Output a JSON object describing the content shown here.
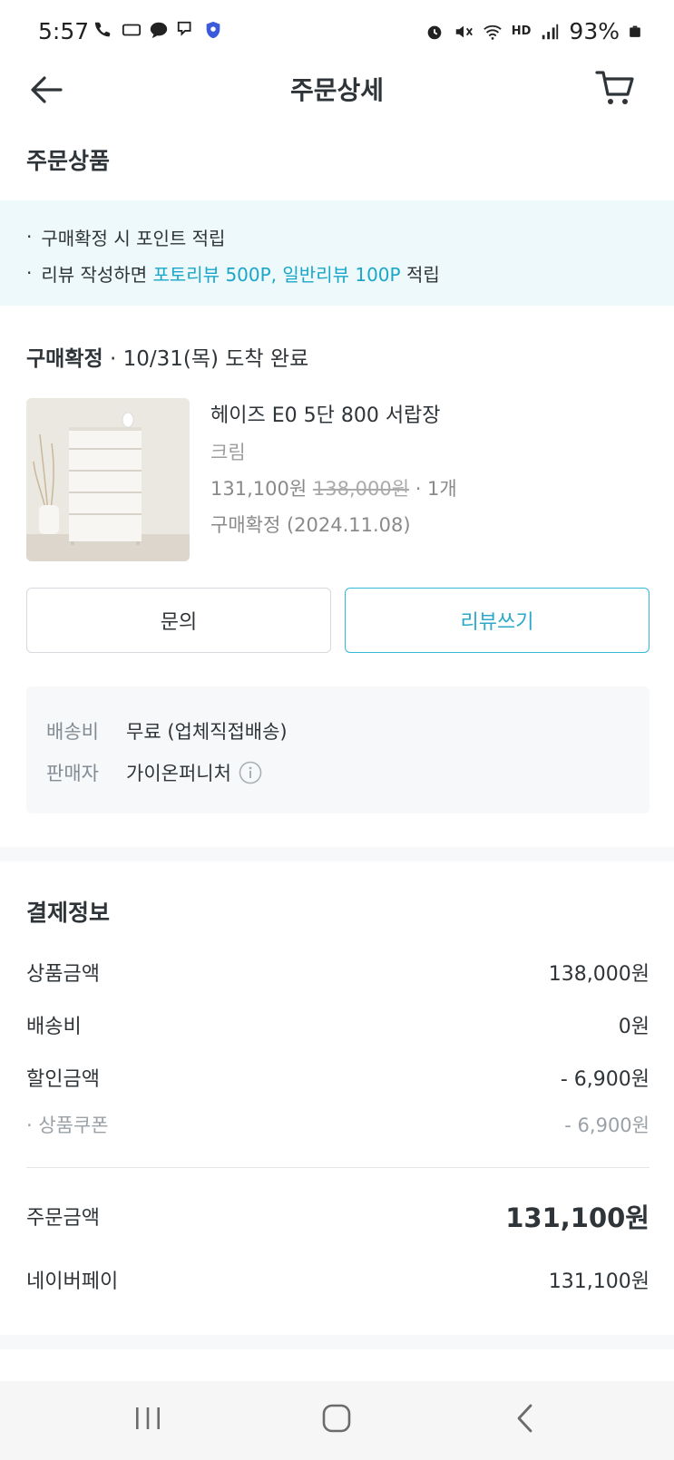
{
  "status_bar": {
    "time": "5:57",
    "battery": "93%",
    "hd_label": "HD"
  },
  "header": {
    "title": "주문상세"
  },
  "order_products_title": "주문상품",
  "notice": {
    "line1": "구매확정 시 포인트 적립",
    "line2_prefix": "리뷰 작성하면 ",
    "line2_highlight": "포토리뷰 500P, 일반리뷰 100P",
    "line2_suffix": " 적립"
  },
  "order_status": {
    "label": "구매확정",
    "detail": " · 10/31(목) 도착 완료"
  },
  "product": {
    "name": "헤이즈 E0 5단 800 서랍장",
    "option": "크림",
    "price": "131,100원",
    "original_price": "138,000원",
    "quantity": " · 1개",
    "confirm_date": "구매확정 (2024.11.08)"
  },
  "buttons": {
    "inquiry": "문의",
    "review": "리뷰쓰기"
  },
  "delivery": {
    "fee_label": "배송비",
    "fee_value": "무료 (업체직접배송)",
    "seller_label": "판매자",
    "seller_value": "가이온퍼니처"
  },
  "payment": {
    "title": "결제정보",
    "rows": [
      {
        "label": "상품금액",
        "amount": "138,000원"
      },
      {
        "label": "배송비",
        "amount": "0원"
      },
      {
        "label": "할인금액",
        "amount": "- 6,900원"
      },
      {
        "label": "· 상품쿠폰",
        "amount": "- 6,900원"
      }
    ],
    "total_label": "주문금액",
    "total_amount": "131,100원",
    "method_label": "네이버페이",
    "method_amount": "131,100원"
  },
  "colors": {
    "accent": "#1aa6c9",
    "notice_bg": "#eef9fb",
    "text": "#2f3438"
  }
}
